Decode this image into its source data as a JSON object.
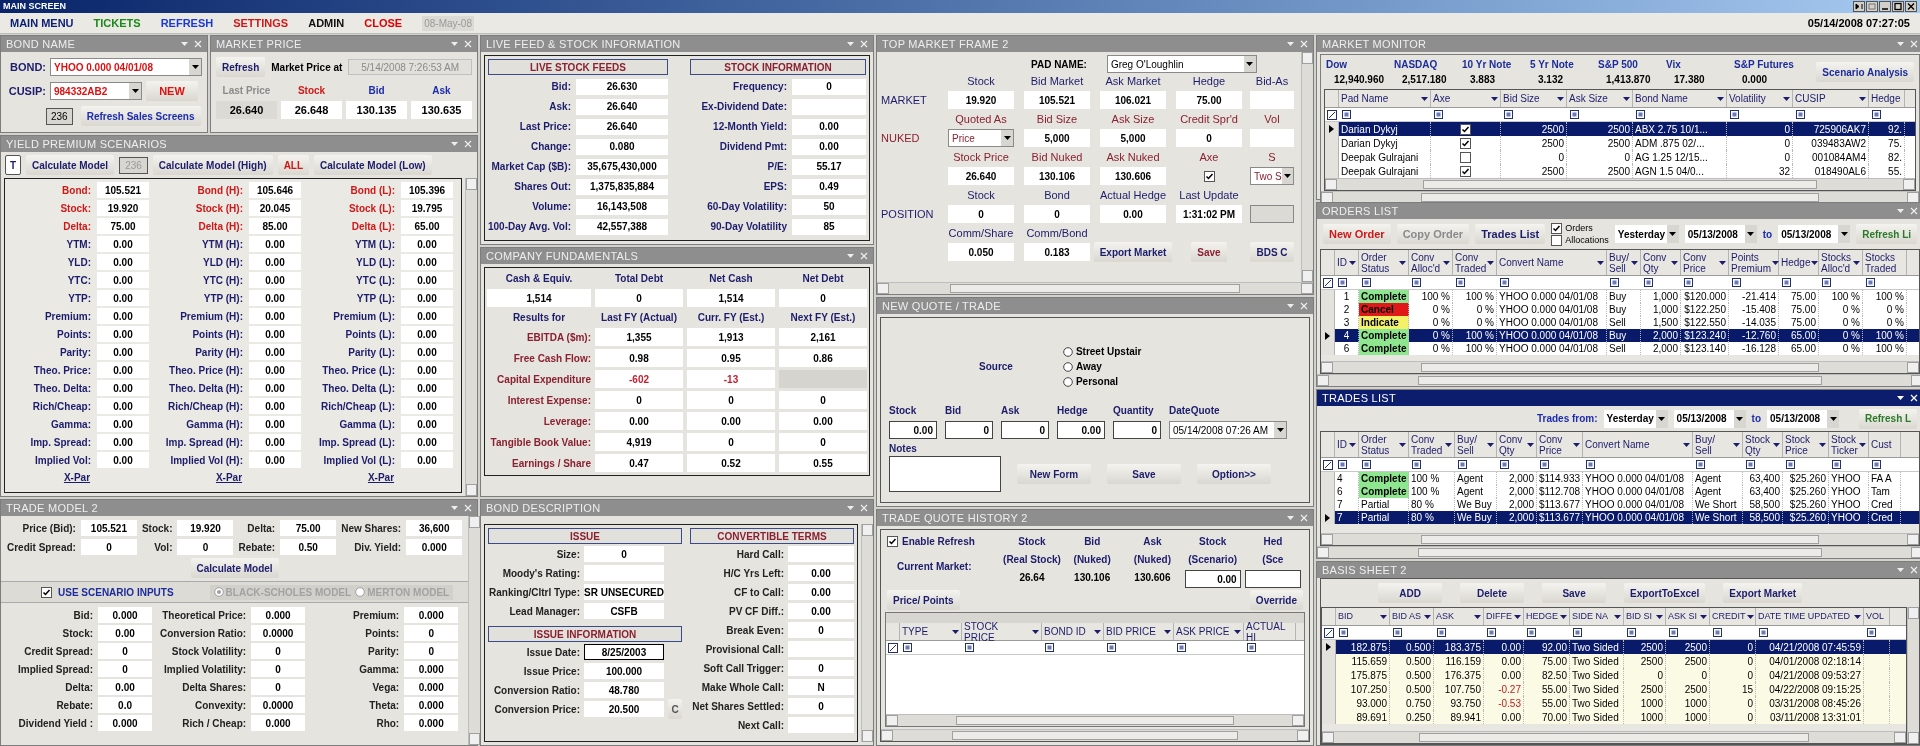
{
  "window": {
    "title": "MAIN SCREEN",
    "clock": "05/14/2008 07:27:05"
  },
  "menu": {
    "items": [
      {
        "label": "MAIN MENU",
        "color": "#0a1e78"
      },
      {
        "label": "TICKETS",
        "color": "#1a8a1a"
      },
      {
        "label": "REFRESH",
        "color": "#1a3ad8"
      },
      {
        "label": "SETTINGS",
        "color": "#d01818"
      },
      {
        "label": "ADMIN",
        "color": "#101010"
      },
      {
        "label": "CLOSE",
        "color": "#e00000"
      }
    ],
    "date": "08-May-08"
  },
  "bond_name": {
    "title": "BOND NAME",
    "bond_label": "BOND:",
    "bond": "YHOO 0.000 04/01/08",
    "cusip_label": "CUSIP:",
    "cusip": "984332AB2",
    "new_button": "NEW",
    "count": "236",
    "refresh_button": "Refresh Sales Screens"
  },
  "market_price": {
    "title": "MARKET PRICE",
    "refresh_button": "Refresh",
    "at_label": "Market Price at",
    "timestamp": "5/14/2008 7:26:53 AM",
    "quotes": [
      {
        "label": "Last Price",
        "value": "26.640",
        "kind": "last"
      },
      {
        "label": "Stock",
        "value": "26.648",
        "kind": "stock"
      },
      {
        "label": "Bid",
        "value": "130.135",
        "kind": "quote"
      },
      {
        "label": "Ask",
        "value": "130.635",
        "kind": "quote"
      }
    ]
  },
  "yield_premium": {
    "title": "YIELD PREMIUM SCENARIOS",
    "toolbar": [
      {
        "label": "T",
        "kind": "small"
      },
      {
        "label": "Calculate Model",
        "kind": "button"
      },
      {
        "label": "236",
        "kind": "count"
      },
      {
        "label": "Calculate Model (High)",
        "kind": "button"
      },
      {
        "label": "ALL",
        "kind": "alert"
      },
      {
        "label": "Calculate Model (Low)",
        "kind": "button"
      }
    ],
    "columns": [
      {
        "link": "X-Par",
        "rows": [
          {
            "label": "Bond:",
            "value": "105.521",
            "key": true
          },
          {
            "label": "Stock:",
            "value": "19.920",
            "key": true
          },
          {
            "label": "Delta:",
            "value": "75.00",
            "key": true
          },
          {
            "label": "YTM:",
            "value": "0.00",
            "key": false
          },
          {
            "label": "YLD:",
            "value": "0.00",
            "key": false
          },
          {
            "label": "YTC:",
            "value": "0.00",
            "key": false
          },
          {
            "label": "YTP:",
            "value": "0.00",
            "key": false
          },
          {
            "label": "Premium:",
            "value": "0.00",
            "key": false
          },
          {
            "label": "Points:",
            "value": "0.00",
            "key": false
          },
          {
            "label": "Parity:",
            "value": "0.00",
            "key": false
          },
          {
            "label": "Theo. Price:",
            "value": "0.00",
            "key": false
          },
          {
            "label": "Theo. Delta:",
            "value": "0.00",
            "key": false
          },
          {
            "label": "Rich/Cheap:",
            "value": "0.00",
            "key": false
          },
          {
            "label": "Gamma:",
            "value": "0.00",
            "key": false
          },
          {
            "label": "Imp. Spread:",
            "value": "0.00",
            "key": false
          },
          {
            "label": "Implied Vol:",
            "value": "0.00",
            "key": false
          }
        ]
      },
      {
        "link": "X-Par",
        "rows": [
          {
            "label": "Bond (H):",
            "value": "105.646",
            "key": true
          },
          {
            "label": "Stock (H):",
            "value": "20.045",
            "key": true
          },
          {
            "label": "Delta (H):",
            "value": "85.00",
            "key": true
          },
          {
            "label": "YTM (H):",
            "value": "0.00",
            "key": false
          },
          {
            "label": "YLD (H):",
            "value": "0.00",
            "key": false
          },
          {
            "label": "YTC (H):",
            "value": "0.00",
            "key": false
          },
          {
            "label": "YTP (H):",
            "value": "0.00",
            "key": false
          },
          {
            "label": "Premium (H):",
            "value": "0.00",
            "key": false
          },
          {
            "label": "Points (H):",
            "value": "0.00",
            "key": false
          },
          {
            "label": "Parity (H):",
            "value": "0.00",
            "key": false
          },
          {
            "label": "Theo. Price (H):",
            "value": "0.00",
            "key": false
          },
          {
            "label": "Theo. Delta (H):",
            "value": "0.00",
            "key": false
          },
          {
            "label": "Rich/Cheap (H):",
            "value": "0.00",
            "key": false
          },
          {
            "label": "Gamma (H):",
            "value": "0.00",
            "key": false
          },
          {
            "label": "Imp. Spread (H):",
            "value": "0.00",
            "key": false
          },
          {
            "label": "Implied Vol (H):",
            "value": "0.00",
            "key": false
          }
        ]
      },
      {
        "link": "X-Par",
        "rows": [
          {
            "label": "Bond (L):",
            "value": "105.396",
            "key": true
          },
          {
            "label": "Stock (L):",
            "value": "19.795",
            "key": true
          },
          {
            "label": "Delta (L):",
            "value": "65.00",
            "key": true
          },
          {
            "label": "YTM (L):",
            "value": "0.00",
            "key": false
          },
          {
            "label": "YLD (L):",
            "value": "0.00",
            "key": false
          },
          {
            "label": "YTC (L):",
            "value": "0.00",
            "key": false
          },
          {
            "label": "YTP (L):",
            "value": "0.00",
            "key": false
          },
          {
            "label": "Premium (L):",
            "value": "0.00",
            "key": false
          },
          {
            "label": "Points (L):",
            "value": "0.00",
            "key": false
          },
          {
            "label": "Parity (L):",
            "value": "0.00",
            "key": false
          },
          {
            "label": "Theo. Price (L):",
            "value": "0.00",
            "key": false
          },
          {
            "label": "Theo. Delta (L):",
            "value": "0.00",
            "key": false
          },
          {
            "label": "Rich/Cheap (L):",
            "value": "0.00",
            "key": false
          },
          {
            "label": "Gamma (L):",
            "value": "0.00",
            "key": false
          },
          {
            "label": "Imp. Spread (L):",
            "value": "0.00",
            "key": false
          },
          {
            "label": "Implied Vol (L):",
            "value": "0.00",
            "key": false
          }
        ]
      }
    ]
  },
  "trade_model": {
    "title": "TRADE MODEL 2",
    "inputs": [
      {
        "label": "Price (Bid):",
        "value": "105.521"
      },
      {
        "label": "Stock:",
        "value": "19.920"
      },
      {
        "label": "Delta:",
        "value": "75.00"
      },
      {
        "label": "New Shares:",
        "value": "36,600"
      },
      {
        "label": "Credit Spread:",
        "value": "0"
      },
      {
        "label": "Vol:",
        "value": "0"
      },
      {
        "label": "Rebate:",
        "value": "0.50"
      },
      {
        "label": "Div. Yield:",
        "value": "0.000"
      }
    ],
    "calculate_button": "Calculate Model",
    "scenario_inputs": {
      "label": "USE SCENARIO INPUTS",
      "checked": true
    },
    "models_disabled": true,
    "models": [
      {
        "label": "BLACK-SCHOLES MODEL",
        "selected": true
      },
      {
        "label": "MERTON MODEL",
        "selected": false
      }
    ],
    "outputs": [
      [
        {
          "label": "Bid:",
          "value": "0.000"
        },
        {
          "label": "Stock:",
          "value": "0.00"
        },
        {
          "label": "Credit Spread:",
          "value": "0"
        },
        {
          "label": "Implied Spread:",
          "value": "0"
        },
        {
          "label": "Delta:",
          "value": "0.00"
        },
        {
          "label": "Rebate:",
          "value": "0.0"
        },
        {
          "label": "Dividend Yield :",
          "value": "0.000"
        }
      ],
      [
        {
          "label": "Theoretical Price:",
          "value": "0.000"
        },
        {
          "label": "Conversion Ratio:",
          "value": "0.0000"
        },
        {
          "label": "Stock Volatility:",
          "value": "0"
        },
        {
          "label": "Implied Volatility:",
          "value": "0"
        },
        {
          "label": "Delta Shares:",
          "value": "0"
        },
        {
          "label": "Convexity:",
          "value": "0.0000"
        },
        {
          "label": "Rich / Cheap:",
          "value": "0.000"
        }
      ],
      [
        {
          "label": "Premium:",
          "value": "0.000"
        },
        {
          "label": "Points:",
          "value": "0"
        },
        {
          "label": "Parity:",
          "value": "0"
        },
        {
          "label": "Gamma:",
          "value": "0.000"
        },
        {
          "label": "Vega:",
          "value": "0.000"
        },
        {
          "label": "Theta:",
          "value": "0.000"
        },
        {
          "label": "Rho:",
          "value": "0.000"
        }
      ]
    ]
  },
  "live_feed": {
    "title": "LIVE FEED & STOCK INFORMATION",
    "sections": [
      {
        "heading": "LIVE STOCK FEEDS",
        "rows": [
          {
            "label": "Bid:",
            "value": "26.630"
          },
          {
            "label": "Ask:",
            "value": "26.640"
          },
          {
            "label": "Last Price:",
            "value": "26.640"
          },
          {
            "label": "Change:",
            "value": "0.080"
          },
          {
            "label": "Market Cap ($B):",
            "value": "35,675,430,000"
          },
          {
            "label": "Shares Out:",
            "value": "1,375,835,884"
          },
          {
            "label": "Volume:",
            "value": "16,143,508"
          },
          {
            "label": "100-Day Avg. Vol:",
            "value": "42,557,388"
          }
        ]
      },
      {
        "heading": "STOCK INFORMATION",
        "rows": [
          {
            "label": "Frequency:",
            "value": "0"
          },
          {
            "label": "Ex-Dividend Date:"
          },
          {
            "label": "12-Month Yield:",
            "value": "0.00"
          },
          {
            "label": "Dividend Pmt:",
            "value": "0.00"
          },
          {
            "label": "P/E:",
            "value": "55.17"
          },
          {
            "label": "EPS:",
            "value": "0.49"
          },
          {
            "label": "60-Day Volatility:",
            "value": "50"
          },
          {
            "label": "90-Day Volatility",
            "value": "85"
          }
        ]
      }
    ]
  },
  "company_fundamentals": {
    "title": "COMPANY FUNDAMENTALS",
    "summary": [
      {
        "label": "Cash & Equiv.",
        "value": "1,514"
      },
      {
        "label": "Total Debt",
        "value": "0"
      },
      {
        "label": "Net Cash",
        "value": "1,514"
      },
      {
        "label": "Net Debt",
        "value": "0"
      }
    ],
    "results_header": [
      "Results for",
      "Last FY (Actual)",
      "Curr. FY (Est.)",
      "Next FY (Est.)"
    ],
    "results": [
      {
        "label": "EBITDA ($m):",
        "values": [
          "1,355",
          "1,913",
          "2,161"
        ],
        "negative": false
      },
      {
        "label": "Free Cash Flow:",
        "values": [
          "0.98",
          "0.95",
          "0.86"
        ],
        "negative": false
      },
      {
        "label": "Capital Expenditure",
        "values": [
          "-602",
          "-13"
        ],
        "negative": true
      },
      {
        "label": "Interest Expense:",
        "values": [
          "0",
          "0",
          "0"
        ],
        "negative": false
      },
      {
        "label": "Leverage:",
        "values": [
          "0.00",
          "0.00",
          "0.00"
        ],
        "negative": false
      },
      {
        "label": "Tangible Book Value:",
        "values": [
          "4,919",
          "0",
          "0"
        ],
        "negative": false
      },
      {
        "label": "Earnings / Share",
        "values": [
          "0.47",
          "0.52",
          "0.55"
        ],
        "negative": false
      }
    ]
  },
  "bond_description": {
    "title": "BOND DESCRIPTION",
    "issue": {
      "heading": "ISSUE",
      "rows": [
        {
          "label": "Size:",
          "value": "0"
        },
        {
          "label": "Moody's Rating:"
        },
        {
          "label": "Ranking/Cltrl Type:",
          "value": "SR UNSECURED"
        },
        {
          "label": "Lead Manager:",
          "value": "CSFB"
        }
      ]
    },
    "issue_information": {
      "heading": "ISSUE INFORMATION",
      "rows": [
        {
          "label": "Issue Date:",
          "value": "8/25/2003",
          "focused": true
        },
        {
          "label": "Issue Price:",
          "value": "100.000",
          "focused": false
        },
        {
          "label": "Conversion Ratio:",
          "value": "48.780",
          "focused": false
        },
        {
          "label": "Conversion Price:",
          "value": "20.500",
          "focused": false,
          "button": "C"
        }
      ]
    },
    "convertible_terms": {
      "heading": "CONVERTIBLE TERMS",
      "rows": [
        {
          "label": "Hard Call:"
        },
        {
          "label": "H/C Yrs Left:",
          "value": "0.00"
        },
        {
          "label": "CF to Call:",
          "value": "0.00"
        },
        {
          "label": "PV CF Diff.:",
          "value": "0.00"
        },
        {
          "label": "Break Even:",
          "value": "0"
        },
        {
          "label": "Provisional Call:"
        },
        {
          "label": "Soft Call Trigger:",
          "value": "0"
        },
        {
          "label": "Make Whole Call:",
          "value": "N"
        },
        {
          "label": "Net Shares Settled:",
          "value": "0"
        },
        {
          "label": "Next Call:"
        }
      ]
    }
  },
  "top_market_frame": {
    "title": "TOP MARKET FRAME 2",
    "pad_label": "PAD NAME:",
    "pad_name": "Greg O'Loughlin",
    "rows": [
      {
        "side": "MARKET",
        "nuked": false,
        "cells": [
          {
            "label": "Stock",
            "kind": "text",
            "value": "19.920"
          },
          {
            "label": "Bid Market",
            "kind": "text",
            "value": "105.521"
          },
          {
            "label": "Ask Market",
            "kind": "text",
            "value": "106.021"
          },
          {
            "label": "Hedge",
            "kind": "text",
            "value": "75.00"
          },
          {
            "label": "Bid-As",
            "kind": "text"
          }
        ]
      },
      {
        "side": "NUKED",
        "nuked": true,
        "cells": [
          {
            "label": "Quoted As",
            "kind": "select",
            "value": "Price"
          },
          {
            "label": "Bid Size",
            "kind": "text",
            "value": "5,000"
          },
          {
            "label": "Ask Size",
            "kind": "text",
            "value": "5,000"
          },
          {
            "label": "Credit Spr'd",
            "kind": "text",
            "value": "0"
          },
          {
            "label": "Vol",
            "kind": "text"
          }
        ]
      },
      {
        "nuked": true,
        "cells": [
          {
            "label": "Stock Price",
            "kind": "text",
            "value": "26.640"
          },
          {
            "label": "Bid Nuked",
            "kind": "text",
            "value": "130.106"
          },
          {
            "label": "Ask Nuked",
            "kind": "text",
            "value": "130.606"
          },
          {
            "label": "Axe",
            "kind": "checkbox",
            "checked": true
          },
          {
            "label": "S",
            "kind": "select",
            "value": "Two S"
          }
        ]
      },
      {
        "side": "POSITION",
        "nuked": false,
        "cells": [
          {
            "label": "Stock",
            "kind": "text",
            "value": "0"
          },
          {
            "label": "Bond",
            "kind": "text",
            "value": "0"
          },
          {
            "label": "Actual Hedge",
            "kind": "text",
            "value": "0.00"
          },
          {
            "label": "Last Update",
            "kind": "text",
            "value": "1:31:02 PM"
          },
          {
            "kind": "box"
          }
        ]
      },
      {
        "nuked": false,
        "cells": [
          {
            "label": "Comm/Share",
            "kind": "text",
            "value": "0.050"
          },
          {
            "label": "Comm/Bond",
            "kind": "text",
            "value": "0.183"
          },
          {
            "kind": "button",
            "value": "Export Market",
            "alert": false
          },
          {
            "kind": "button",
            "value": "Save",
            "alert": true
          },
          {
            "kind": "button",
            "value": "BDS C",
            "alert": false
          }
        ]
      }
    ]
  },
  "new_quote": {
    "title": "NEW QUOTE / TRADE",
    "source_label": "Source",
    "sources": [
      {
        "label": "Street Upstair",
        "selected": false
      },
      {
        "label": "Away",
        "selected": false
      },
      {
        "label": "Personal",
        "selected": false
      }
    ],
    "fields": [
      {
        "label": "Stock",
        "value": "0.00",
        "kind": "input"
      },
      {
        "label": "Bid",
        "value": "0",
        "kind": "input"
      },
      {
        "label": "Ask",
        "value": "0",
        "kind": "input"
      },
      {
        "label": "Hedge",
        "value": "0.00",
        "kind": "input"
      },
      {
        "label": "Quantity",
        "value": "0",
        "kind": "input"
      },
      {
        "label": "DateQuote",
        "value": "05/14/2008 07:26 AM",
        "kind": "select"
      }
    ],
    "notes_label": "Notes",
    "buttons": [
      "New Form",
      "Save",
      "Option>>"
    ]
  },
  "trade_quote_history": {
    "title": "TRADE QUOTE HISTORY 2",
    "enable_refresh": {
      "label": "Enable Refresh",
      "checked": true
    },
    "current_market_label": "Current Market:",
    "market": [
      {
        "label": "Stock",
        "sub": "(Real Stock)",
        "value": "26.64",
        "kind": "text"
      },
      {
        "label": "Bid",
        "sub": "(Nuked)",
        "value": "130.106",
        "kind": "text"
      },
      {
        "label": "Ask",
        "sub": "(Nuked)",
        "value": "130.606",
        "kind": "text"
      },
      {
        "label": "Stock",
        "sub": "(Scenario)",
        "value": "0.00",
        "kind": "input"
      },
      {
        "label": "Hed",
        "sub": "(Sce",
        "kind": "input"
      }
    ],
    "price_points_button": "Price/ Points",
    "override_button": "Override",
    "columns": [
      "TYPE",
      "STOCK PRICE",
      "BOND ID",
      "BID PRICE",
      "ASK PRICE",
      "ACTUAL HI"
    ]
  },
  "market_monitor": {
    "title": "MARKET MONITOR",
    "indices": [
      {
        "name": "Dow",
        "value": "12,940.960"
      },
      {
        "name": "NASDAQ",
        "value": "2,517.180"
      },
      {
        "name": "10 Yr Note",
        "value": "3.883"
      },
      {
        "name": "5 Yr Note",
        "value": "3.132"
      },
      {
        "name": "S&P 500",
        "value": "1,413.870"
      },
      {
        "name": "Vix",
        "value": "17.380"
      },
      {
        "name": "S&P Futures",
        "value": "0.000"
      }
    ],
    "scenario_button": "Scenario Analysis",
    "columns": [
      "Pad Name",
      "Axe",
      "Bid Size",
      "Ask Size",
      "Bond Name",
      "Volatility",
      "CUSIP",
      "Hedge"
    ],
    "rows": [
      {
        "selected": true,
        "cells": [
          "Darian Dykyj",
          {
            "checked": true
          },
          "2500",
          "2500",
          "ABX 2.75 10/1...",
          "0",
          "725906AK7",
          "92."
        ]
      },
      {
        "selected": false,
        "cells": [
          "Darian Dykyj",
          {
            "checked": true
          },
          "2500",
          "2500",
          "ADM .875 02/...",
          "0",
          "039483AW2",
          "75."
        ]
      },
      {
        "selected": false,
        "cells": [
          "Deepak Gulrajani",
          {
            "checked": false
          },
          "0",
          "0",
          "AG 1.25 12/15...",
          "0",
          "001084AM4",
          "82."
        ]
      },
      {
        "selected": false,
        "cells": [
          "Deepak Gulrajani",
          {
            "checked": true
          },
          "2500",
          "2500",
          "AGN 1.5 04/0...",
          "32",
          "018490AL6",
          "55."
        ]
      }
    ]
  },
  "orders_list": {
    "title": "ORDERS LIST",
    "buttons": [
      {
        "label": "New Order",
        "kind": "alert"
      },
      {
        "label": "Copy Order",
        "kind": "disabled"
      },
      {
        "label": "Trades List",
        "kind": "normal"
      }
    ],
    "filters": [
      {
        "label": "Orders",
        "checked": true
      },
      {
        "label": "Allocations",
        "checked": false
      }
    ],
    "period": "Yesterday",
    "from": "05/13/2008",
    "to_label": "to",
    "to": "05/13/2008",
    "refresh_button": "Refresh Li",
    "columns": [
      "ID",
      "Order Status",
      "Conv Alloc'd",
      "Conv Traded",
      "Convert Name",
      "Buy/ Sell",
      "Conv Qty",
      "Conv Price",
      "Points Premium",
      "Hedge",
      "Stocks Alloc'd",
      "Stocks Traded"
    ],
    "rows": [
      {
        "selected": false,
        "cells": [
          "1",
          {
            "text": "Complete",
            "color": "#8ee68e"
          },
          "100 %",
          "100 %",
          "YHOO 0.000 04/01/08",
          "Buy",
          "1,000",
          "$120.000",
          "-21.414",
          "75.00",
          "100 %",
          "100 %"
        ]
      },
      {
        "selected": false,
        "cells": [
          "2",
          {
            "text": "Cancel",
            "color": "#e01818"
          },
          "0 %",
          "0 %",
          "YHOO 0.000 04/01/08",
          "Buy",
          "1,000",
          "$122.250",
          "-15.408",
          "75.00",
          "0 %",
          "0 %"
        ]
      },
      {
        "selected": false,
        "cells": [
          "3",
          {
            "text": "Indicate",
            "color": "#f4f06a"
          },
          "0 %",
          "0 %",
          "YHOO 0.000 04/01/08",
          "Sell",
          "1,500",
          "$122.550",
          "-14.035",
          "75.00",
          "0 %",
          "0 %"
        ]
      },
      {
        "selected": true,
        "cells": [
          "4",
          {
            "text": "Complete",
            "color": "#8ee68e"
          },
          "0 %",
          "100 %",
          "YHOO 0.000 04/01/08",
          "Buy",
          "2,000",
          "$123.240",
          "-12.760",
          "65.00",
          "0 %",
          "100 %"
        ]
      },
      {
        "selected": false,
        "cells": [
          "6",
          {
            "text": "Complete",
            "color": "#8ee68e"
          },
          "0 %",
          "100 %",
          "YHOO 0.000 04/01/08",
          "Sell",
          "2,000",
          "$123.140",
          "-16.128",
          "65.00",
          "0 %",
          "100 %"
        ]
      }
    ]
  },
  "trades_list": {
    "title": "TRADES LIST",
    "active": true,
    "from_label": "Trades from:",
    "period": "Yesterday",
    "from": "05/13/2008",
    "to_label": "to",
    "to": "05/13/2008",
    "refresh_button": "Refresh L",
    "columns": [
      "ID",
      "Order Status",
      "Conv Traded",
      "Buy/ Sell",
      "Conv Qty",
      "Conv Price",
      "Convert Name",
      "Buy/ Sell",
      "Stock Qty",
      "Stock Price",
      "Stock Ticker",
      "Cust"
    ],
    "rows": [
      {
        "selected": false,
        "cells": [
          "4",
          {
            "text": "Complete",
            "color": "#8ee68e"
          },
          "100 %",
          "Agent",
          "2,000",
          "$114.933",
          "YHOO 0.000 04/01/08",
          "Agent",
          "63,400",
          "$25.260",
          "YHOO",
          "FA A"
        ]
      },
      {
        "selected": false,
        "cells": [
          "6",
          {
            "text": "Complete",
            "color": "#8ee68e"
          },
          "100 %",
          "Agent",
          "2,000",
          "$112.708",
          "YHOO 0.000 04/01/08",
          "Agent",
          "63,400",
          "$25.260",
          "YHOO",
          "Tam"
        ]
      },
      {
        "selected": false,
        "cells": [
          "7",
          "Partial",
          "80 %",
          "We Buy",
          "2,000",
          "$113.677",
          "YHOO 0.000 04/01/08",
          "We Short",
          "58,500",
          "$25.260",
          "YHOO",
          "Cred"
        ]
      },
      {
        "selected": true,
        "cells": [
          "7",
          "Partial",
          "80 %",
          "We Buy",
          "2,000",
          "$113.677",
          "YHOO 0.000 04/01/08",
          "We Short",
          "58,500",
          "$25.260",
          "YHOO",
          "Cred"
        ]
      }
    ]
  },
  "basis_sheet": {
    "title": "BASIS SHEET 2",
    "buttons": [
      "ADD",
      "Delete",
      "Save",
      "ExportToExcel",
      "Export Market"
    ],
    "columns": [
      "BID",
      "BID AS",
      "ASK",
      "DIFFE",
      "HEDGE",
      "SIDE NA",
      "BID SI",
      "ASK SI",
      "CREDIT",
      "DATE TIME UPDATED",
      "VOL"
    ],
    "rows": [
      {
        "selected": true,
        "cells": [
          "182.875",
          "0.500",
          "183.375",
          {
            "text": "0.00",
            "negative": false
          },
          "92.00",
          "Two Sided",
          "2500",
          "2500",
          "0",
          "04/21/2008 07:45:59"
        ]
      },
      {
        "selected": false,
        "cells": [
          "115.659",
          "0.500",
          "116.159",
          {
            "text": "0.00",
            "negative": false
          },
          "75.00",
          "Two Sided",
          "2500",
          "2500",
          "0",
          "04/01/2008 02:18:14"
        ]
      },
      {
        "selected": false,
        "cells": [
          "175.875",
          "0.500",
          "176.375",
          {
            "text": "0.00",
            "negative": false
          },
          "82.50",
          "Two Sided",
          "0",
          "0",
          "0",
          "04/21/2008 09:53:27"
        ]
      },
      {
        "selected": false,
        "cells": [
          "107.250",
          "0.500",
          "107.750",
          {
            "text": "-0.27",
            "negative": true
          },
          "55.00",
          "Two Sided",
          "2500",
          "2500",
          "15",
          "04/22/2008 09:15:25"
        ]
      },
      {
        "selected": false,
        "cells": [
          "93.000",
          "0.750",
          "93.750",
          {
            "text": "-0.53",
            "negative": true
          },
          "55.00",
          "Two Sided",
          "1000",
          "1000",
          "0",
          "03/31/2008 08:45:26"
        ]
      },
      {
        "selected": false,
        "cells": [
          "89.691",
          "0.250",
          "89.941",
          {
            "text": "0.00",
            "negative": false
          },
          "70.00",
          "Two Sided",
          "1000",
          "1000",
          "0",
          "03/11/2008 13:31:01"
        ]
      }
    ]
  }
}
